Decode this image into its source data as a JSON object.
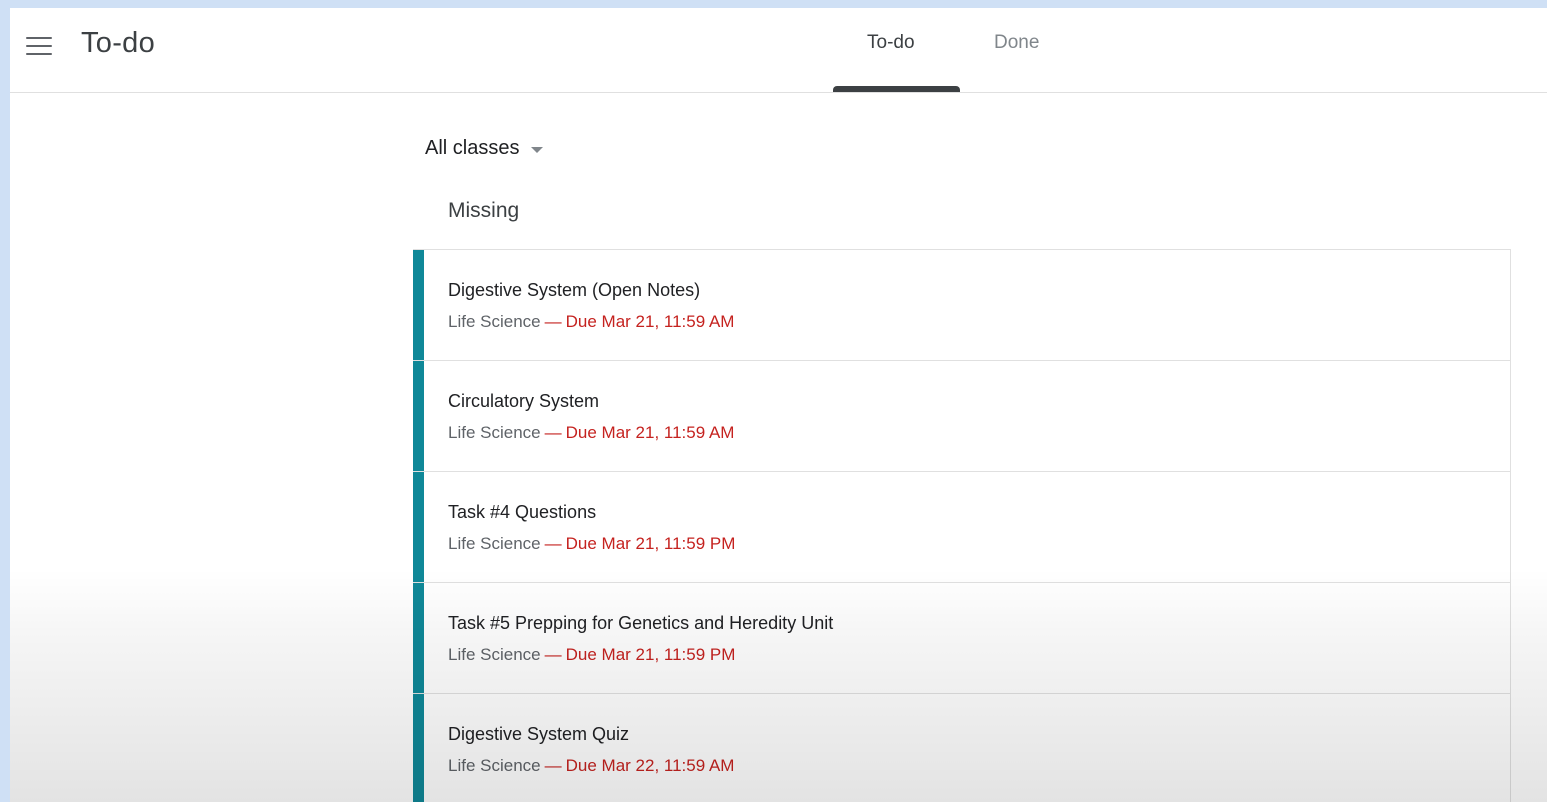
{
  "header": {
    "app_title": "To-do",
    "tabs": [
      {
        "label": "To-do",
        "active": true
      },
      {
        "label": "Done",
        "active": false
      }
    ]
  },
  "filter": {
    "selected": "All classes"
  },
  "section": {
    "title": "Missing"
  },
  "assignments": [
    {
      "title": "Digestive System (Open Notes)",
      "class": "Life Science",
      "separator": "—",
      "due": "Due Mar 21, 11:59 AM"
    },
    {
      "title": "Circulatory System",
      "class": "Life Science",
      "separator": "—",
      "due": "Due Mar 21, 11:59 AM"
    },
    {
      "title": "Task #4 Questions",
      "class": "Life Science",
      "separator": "—",
      "due": "Due Mar 21, 11:59 PM"
    },
    {
      "title": "Task #5 Prepping for Genetics and Heredity Unit",
      "class": "Life Science",
      "separator": "—",
      "due": "Due Mar 21, 11:59 PM"
    },
    {
      "title": "Digestive System Quiz",
      "class": "Life Science",
      "separator": "—",
      "due": "Due Mar 22, 11:59 AM"
    }
  ],
  "icons": {
    "menu": "hamburger-menu-icon",
    "dropdown": "caret-down-icon"
  },
  "colors": {
    "class_accent": "#0f8898",
    "due_text": "#c5221f",
    "page_border": "#cfe0f5"
  }
}
